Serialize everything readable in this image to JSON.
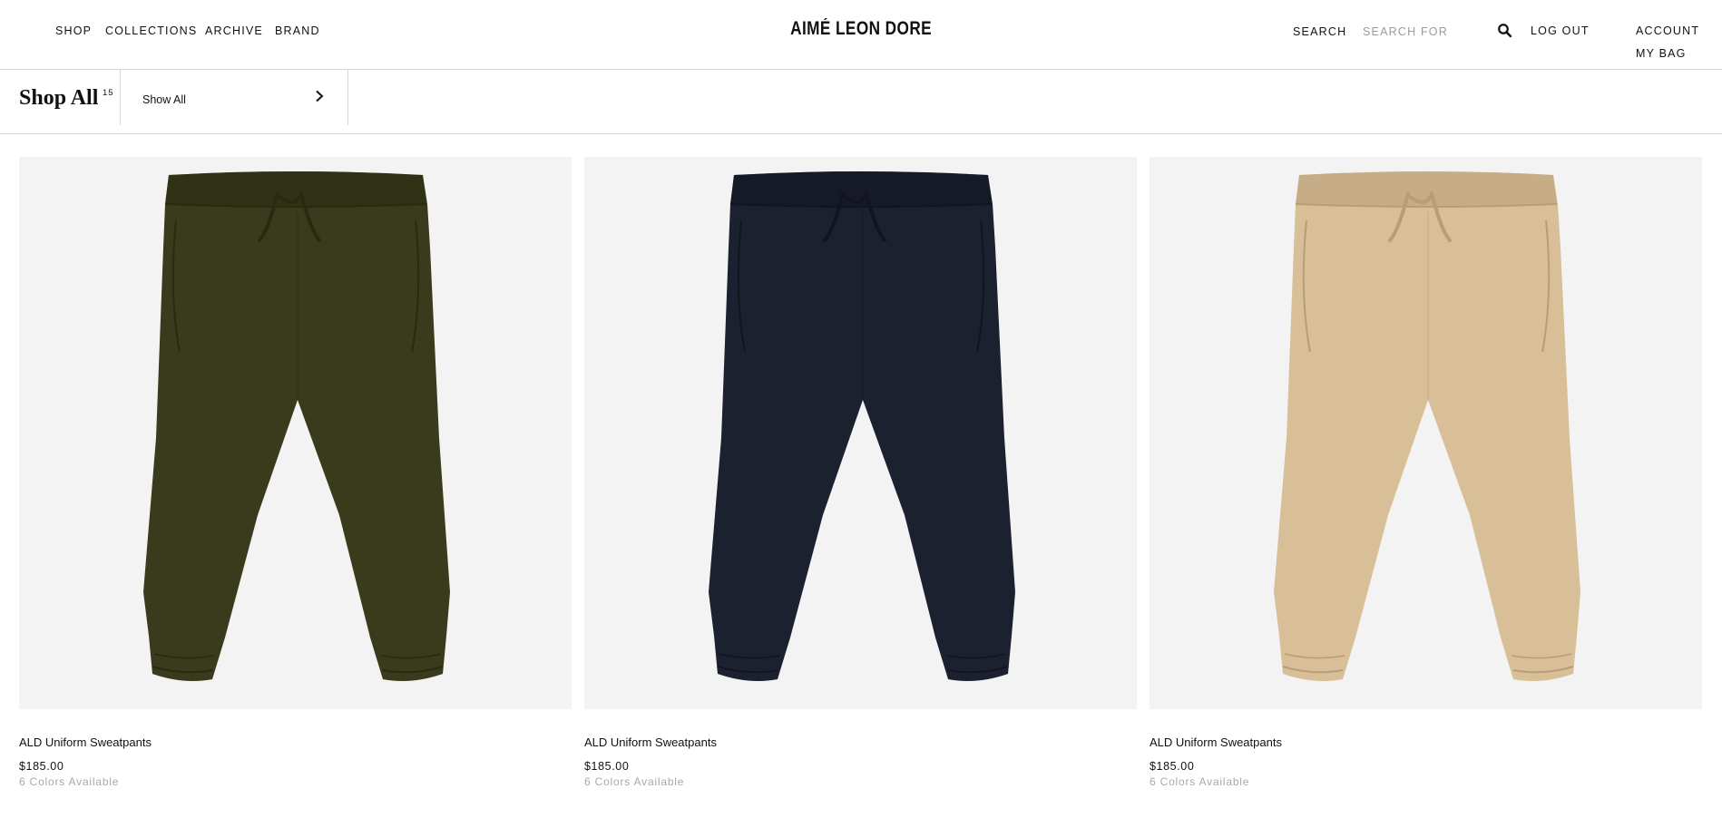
{
  "header": {
    "nav": [
      {
        "label": "SHOP"
      },
      {
        "label": "COLLECTIONS"
      },
      {
        "label": "ARCHIVE"
      },
      {
        "label": "BRAND"
      }
    ],
    "brand": "AIMÉ LEON DORE",
    "search_label": "SEARCH",
    "search_placeholder": "SEARCH FOR",
    "search_icon": "search-icon",
    "logout_label": "LOG OUT",
    "account_label": "ACCOUNT",
    "bag_label": "MY BAG"
  },
  "filter_bar": {
    "title": "Shop All",
    "count": "15",
    "filter_value": "Show All",
    "filter_icon": "chevron-right-icon"
  },
  "colors": {
    "page_background": "#ffffff",
    "image_background": "#f3f3f3",
    "divider": "#d6d6d6",
    "muted_text": "#a8a8a8"
  },
  "products": [
    {
      "name": "ALD Uniform Sweatpants",
      "price": "$185.00",
      "colors_available": "6 Colors Available",
      "garment_color": "#3a3a1c",
      "detail_color": "#2a2a12"
    },
    {
      "name": "ALD Uniform Sweatpants",
      "price": "$185.00",
      "colors_available": "6 Colors Available",
      "garment_color": "#1c2130",
      "detail_color": "#12151f"
    },
    {
      "name": "ALD Uniform Sweatpants",
      "price": "$185.00",
      "colors_available": "6 Colors Available",
      "garment_color": "#d8bf98",
      "detail_color": "#b89e78"
    }
  ]
}
